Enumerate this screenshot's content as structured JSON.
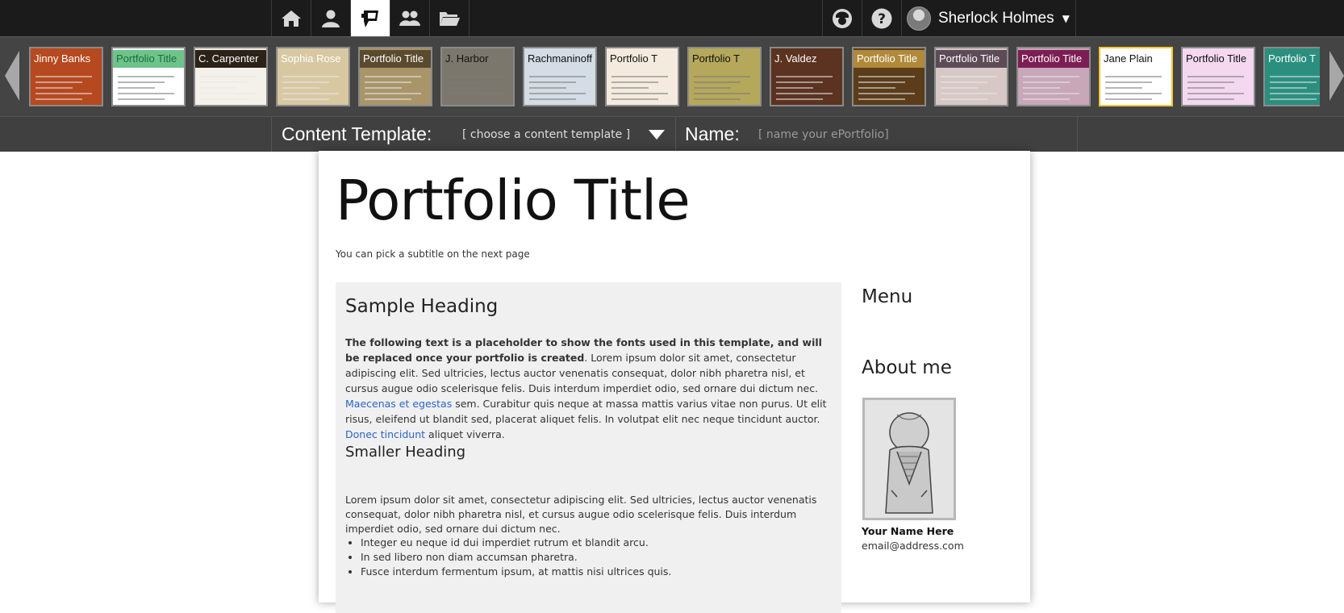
{
  "user": {
    "name": "Sherlock Holmes"
  },
  "nav": {
    "icons": [
      "home-icon",
      "user-icon",
      "portfolio-icon",
      "groups-icon",
      "folder-icon",
      "avatar-help-icon",
      "help-icon"
    ]
  },
  "templates": [
    {
      "label": "Jinny Banks",
      "bg": "#b6491f",
      "fg": "#ffffff"
    },
    {
      "label": "Portfolio Title",
      "bg": "#ffffff",
      "fg": "#1e6b3a",
      "bar": "#6dc48a"
    },
    {
      "label": "C. Carpenter",
      "bg": "#f4f1ea",
      "fg": "#ffffff",
      "bar": "#2c2217"
    },
    {
      "label": "Sophia Rose",
      "bg": "#d8c8a2",
      "fg": "#ffffff"
    },
    {
      "label": "Portfolio Title",
      "bg": "#a9956a",
      "fg": "#ffffff",
      "bar": "#5a4a2e"
    },
    {
      "label": "J. Harbor",
      "bg": "#7c776d",
      "fg": "#111111"
    },
    {
      "label": "Rachmaninoff",
      "bg": "#d4dde5",
      "fg": "#111111"
    },
    {
      "label": "Portfolio T",
      "bg": "#f4ebde",
      "fg": "#111111"
    },
    {
      "label": "Portfolio T",
      "bg": "#b6a85b",
      "fg": "#111111"
    },
    {
      "label": "J. Valdez",
      "bg": "#5b3320",
      "fg": "#ffffff"
    },
    {
      "label": "Portfolio Title",
      "bg": "#5b3d1b",
      "fg": "#ffffff",
      "bar": "#b08a3a"
    },
    {
      "label": "Portfolio Title",
      "bg": "#d7c8c6",
      "fg": "#ffffff",
      "bar": "#5d4b57"
    },
    {
      "label": "Portfolio Title",
      "bg": "#c7a7b8",
      "fg": "#ffffff",
      "bar": "#7c1e54"
    },
    {
      "label": "Jane Plain",
      "bg": "#ffffff",
      "fg": "#111111",
      "selected": true
    },
    {
      "label": "Portfolio Title",
      "bg": "#f3d8ef",
      "fg": "#111111"
    },
    {
      "label": "Portfolio T",
      "bg": "#2b8f7f",
      "fg": "#ffffff"
    }
  ],
  "settings": {
    "content_template_label": "Content Template:",
    "content_template_value": "[ choose a content template ]",
    "name_label": "Name:",
    "name_placeholder": "[ name your ePortfolio]"
  },
  "preview": {
    "title": "Portfolio Title",
    "subtitle": "You can pick a subtitle on the next page",
    "sample_heading": "Sample Heading",
    "para1_bold": "The following text is a placeholder to show the fonts used in this template, and will be replaced once your portfolio is created",
    "para1_a": ". Lorem ipsum dolor sit amet, consectetur adipiscing elit. Sed ultricies, lectus auctor venenatis consequat, dolor nibh pharetra nisl, et cursus augue odio scelerisque felis. Duis interdum imperdiet odio, sed ornare dui dictum nec. ",
    "para1_link1": "Maecenas et egestas",
    "para1_b": " sem. Curabitur quis neque at massa mattis varius vitae non purus. Ut elit risus, eleifend ut blandit sed, placerat aliquet felis. In volutpat elit nec neque tincidunt auctor. ",
    "para1_link2": "Donec tincidunt",
    "para1_c": " aliquet viverra.",
    "smaller_heading": "Smaller Heading",
    "para2": "Lorem ipsum dolor sit amet, consectetur adipiscing elit. Sed ultricies, lectus auctor venenatis consequat, dolor nibh pharetra nisl, et cursus augue odio scelerisque felis. Duis interdum imperdiet odio, sed ornare dui dictum nec.",
    "bullets": [
      "Integer eu neque id dui imperdiet rutrum et blandit arcu.",
      "In sed libero non diam accumsan pharetra.",
      "Fusce interdum fermentum ipsum, at mattis nisi ultrices quis."
    ],
    "sidebar": {
      "menu_heading": "Menu",
      "about_heading": "About me",
      "name": "Your Name Here",
      "email": "email@address.com"
    }
  }
}
